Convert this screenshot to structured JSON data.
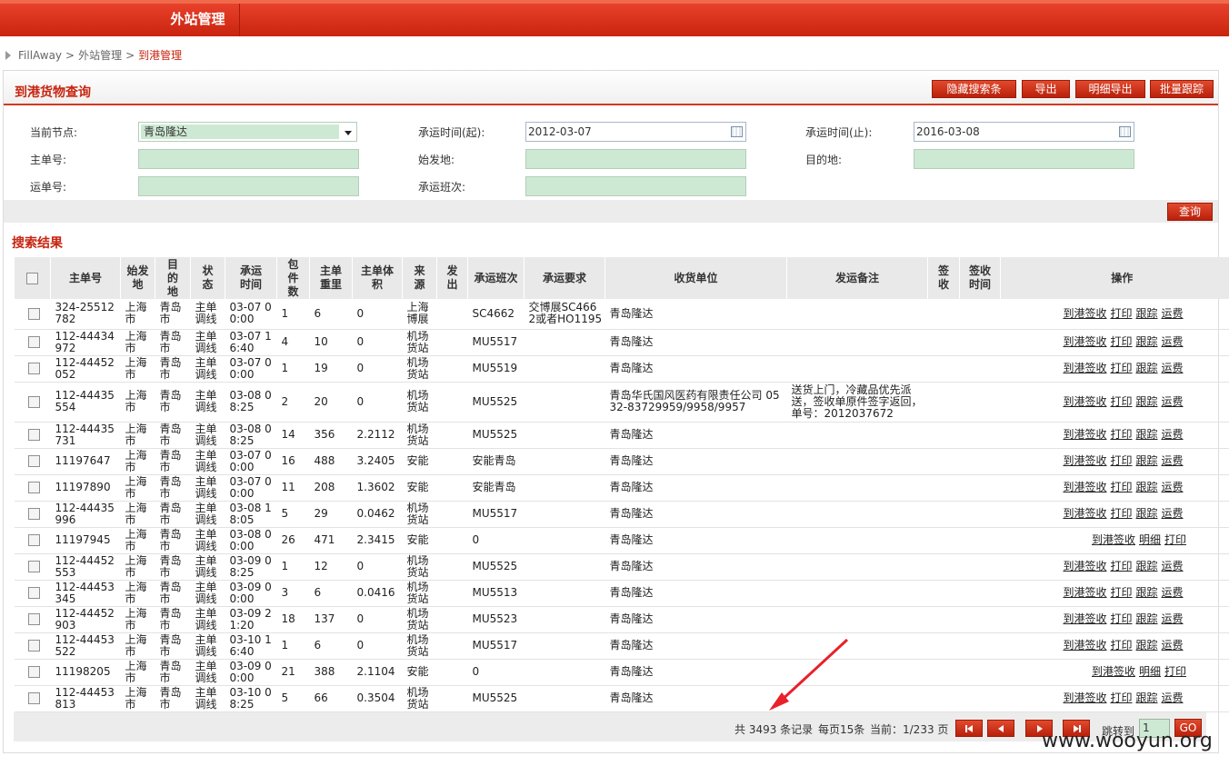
{
  "topbar": {
    "tab": "外站管理"
  },
  "breadcrumb": {
    "items": [
      "FillAway",
      "外站管理"
    ],
    "current": "到港管理",
    "separator": ">"
  },
  "panel": {
    "title": "到港货物查询",
    "buttons": {
      "hide_search": "隐藏搜索条",
      "export": "导出",
      "detail_export": "明细导出",
      "batch_track": "批量跟踪"
    }
  },
  "form": {
    "current_node_label": "当前节点:",
    "current_node_value": "青岛隆达",
    "ship_time_start_label": "承运时间(起):",
    "ship_time_start_value": "2012-03-07",
    "ship_time_end_label": "承运时间(止):",
    "ship_time_end_value": "2016-03-08",
    "master_no_label": "主单号:",
    "origin_label": "始发地:",
    "destination_label": "目的地:",
    "waybill_no_label": "运单号:",
    "flight_label": "承运班次:",
    "query_button": "查询"
  },
  "results": {
    "title": "搜索结果",
    "columns": [
      "主单号",
      "始发地",
      "目的地",
      "状态",
      "承运时间",
      "包件数",
      "主单重里",
      "主单体积",
      "来源",
      "发出",
      "承运班次",
      "承运要求",
      "收货单位",
      "发运备注",
      "签收",
      "签收时间",
      "操作"
    ],
    "rows": [
      {
        "no": "324-25512782",
        "from": "上海市",
        "to": "青岛市",
        "status": "主单调线",
        "time": "03-07 00:00",
        "pieces": "1",
        "weight": "6",
        "volume": "0",
        "source": "上海博展",
        "sent": "",
        "flight": "SC4662",
        "req": "交博展SC4662或者HO1195",
        "receiver": "青岛隆达",
        "remark": "",
        "signed": "",
        "sign_time": "",
        "ops": [
          "到港签收",
          "打印",
          "跟踪",
          "运费"
        ]
      },
      {
        "no": "112-44434972",
        "from": "上海市",
        "to": "青岛市",
        "status": "主单调线",
        "time": "03-07 16:40",
        "pieces": "4",
        "weight": "10",
        "volume": "0",
        "source": "机场货站",
        "sent": "",
        "flight": "MU5517",
        "req": "",
        "receiver": "青岛隆达",
        "remark": "",
        "signed": "",
        "sign_time": "",
        "ops": [
          "到港签收",
          "打印",
          "跟踪",
          "运费"
        ]
      },
      {
        "no": "112-44452052",
        "from": "上海市",
        "to": "青岛市",
        "status": "主单调线",
        "time": "03-07 00:00",
        "pieces": "1",
        "weight": "19",
        "volume": "0",
        "source": "机场货站",
        "sent": "",
        "flight": "MU5519",
        "req": "",
        "receiver": "青岛隆达",
        "remark": "",
        "signed": "",
        "sign_time": "",
        "ops": [
          "到港签收",
          "打印",
          "跟踪",
          "运费"
        ]
      },
      {
        "no": "112-44435554",
        "from": "上海市",
        "to": "青岛市",
        "status": "主单调线",
        "time": "03-08 08:25",
        "pieces": "2",
        "weight": "20",
        "volume": "0",
        "source": "机场货站",
        "sent": "",
        "flight": "MU5525",
        "req": "",
        "receiver": "青岛华氏国风医药有限责任公司 0532-83729959/9958/9957",
        "remark": "送货上门，冷藏品优先派送，签收单原件签字返回，单号：2012037672",
        "signed": "",
        "sign_time": "",
        "ops": [
          "到港签收",
          "打印",
          "跟踪",
          "运费"
        ]
      },
      {
        "no": "112-44435731",
        "from": "上海市",
        "to": "青岛市",
        "status": "主单调线",
        "time": "03-08 08:25",
        "pieces": "14",
        "weight": "356",
        "volume": "2.2112",
        "source": "机场货站",
        "sent": "",
        "flight": "MU5525",
        "req": "",
        "receiver": "青岛隆达",
        "remark": "",
        "signed": "",
        "sign_time": "",
        "ops": [
          "到港签收",
          "打印",
          "跟踪",
          "运费"
        ]
      },
      {
        "no": "11197647",
        "from": "上海市",
        "to": "青岛市",
        "status": "主单调线",
        "time": "03-07 00:00",
        "pieces": "16",
        "weight": "488",
        "volume": "3.2405",
        "source": "安能",
        "sent": "",
        "flight": "安能青岛",
        "req": "",
        "receiver": "青岛隆达",
        "remark": "",
        "signed": "",
        "sign_time": "",
        "ops": [
          "到港签收",
          "打印",
          "跟踪",
          "运费"
        ]
      },
      {
        "no": "11197890",
        "from": "上海市",
        "to": "青岛市",
        "status": "主单调线",
        "time": "03-07 00:00",
        "pieces": "11",
        "weight": "208",
        "volume": "1.3602",
        "source": "安能",
        "sent": "",
        "flight": "安能青岛",
        "req": "",
        "receiver": "青岛隆达",
        "remark": "",
        "signed": "",
        "sign_time": "",
        "ops": [
          "到港签收",
          "打印",
          "跟踪",
          "运费"
        ]
      },
      {
        "no": "112-44435996",
        "from": "上海市",
        "to": "青岛市",
        "status": "主单调线",
        "time": "03-08 18:05",
        "pieces": "5",
        "weight": "29",
        "volume": "0.0462",
        "source": "机场货站",
        "sent": "",
        "flight": "MU5517",
        "req": "",
        "receiver": "青岛隆达",
        "remark": "",
        "signed": "",
        "sign_time": "",
        "ops": [
          "到港签收",
          "打印",
          "跟踪",
          "运费"
        ]
      },
      {
        "no": "11197945",
        "from": "上海市",
        "to": "青岛市",
        "status": "主单调线",
        "time": "03-08 00:00",
        "pieces": "26",
        "weight": "471",
        "volume": "2.3415",
        "source": "安能",
        "sent": "",
        "flight": "0",
        "req": "",
        "receiver": "青岛隆达",
        "remark": "",
        "signed": "",
        "sign_time": "",
        "ops": [
          "到港签收",
          "明细",
          "打印"
        ]
      },
      {
        "no": "112-44452553",
        "from": "上海市",
        "to": "青岛市",
        "status": "主单调线",
        "time": "03-09 08:25",
        "pieces": "1",
        "weight": "12",
        "volume": "0",
        "source": "机场货站",
        "sent": "",
        "flight": "MU5525",
        "req": "",
        "receiver": "青岛隆达",
        "remark": "",
        "signed": "",
        "sign_time": "",
        "ops": [
          "到港签收",
          "打印",
          "跟踪",
          "运费"
        ]
      },
      {
        "no": "112-44453345",
        "from": "上海市",
        "to": "青岛市",
        "status": "主单调线",
        "time": "03-09 00:00",
        "pieces": "3",
        "weight": "6",
        "volume": "0.0416",
        "source": "机场货站",
        "sent": "",
        "flight": "MU5513",
        "req": "",
        "receiver": "青岛隆达",
        "remark": "",
        "signed": "",
        "sign_time": "",
        "ops": [
          "到港签收",
          "打印",
          "跟踪",
          "运费"
        ]
      },
      {
        "no": "112-44452903",
        "from": "上海市",
        "to": "青岛市",
        "status": "主单调线",
        "time": "03-09 21:20",
        "pieces": "18",
        "weight": "137",
        "volume": "0",
        "source": "机场货站",
        "sent": "",
        "flight": "MU5523",
        "req": "",
        "receiver": "青岛隆达",
        "remark": "",
        "signed": "",
        "sign_time": "",
        "ops": [
          "到港签收",
          "打印",
          "跟踪",
          "运费"
        ]
      },
      {
        "no": "112-44453522",
        "from": "上海市",
        "to": "青岛市",
        "status": "主单调线",
        "time": "03-10 16:40",
        "pieces": "1",
        "weight": "6",
        "volume": "0",
        "source": "机场货站",
        "sent": "",
        "flight": "MU5517",
        "req": "",
        "receiver": "青岛隆达",
        "remark": "",
        "signed": "",
        "sign_time": "",
        "ops": [
          "到港签收",
          "打印",
          "跟踪",
          "运费"
        ]
      },
      {
        "no": "11198205",
        "from": "上海市",
        "to": "青岛市",
        "status": "主单调线",
        "time": "03-09 00:00",
        "pieces": "21",
        "weight": "388",
        "volume": "2.1104",
        "source": "安能",
        "sent": "",
        "flight": "0",
        "req": "",
        "receiver": "青岛隆达",
        "remark": "",
        "signed": "",
        "sign_time": "",
        "ops": [
          "到港签收",
          "明细",
          "打印"
        ]
      },
      {
        "no": "112-44453813",
        "from": "上海市",
        "to": "青岛市",
        "status": "主单调线",
        "time": "03-10 08:25",
        "pieces": "5",
        "weight": "66",
        "volume": "0.3504",
        "source": "机场货站",
        "sent": "",
        "flight": "MU5525",
        "req": "",
        "receiver": "青岛隆达",
        "remark": "",
        "signed": "",
        "sign_time": "",
        "ops": [
          "到港签收",
          "打印",
          "跟踪",
          "运费"
        ]
      }
    ]
  },
  "pager": {
    "total": "共 3493 条记录",
    "per_page": "每页15条",
    "current": "当前：1/233 页",
    "jump_label": "跳转到",
    "jump_value": "1",
    "go": "GO"
  },
  "watermark": "www.wooyun.org",
  "colors": {
    "brand_red": "#c7240f",
    "input_green": "#cde9d3"
  }
}
